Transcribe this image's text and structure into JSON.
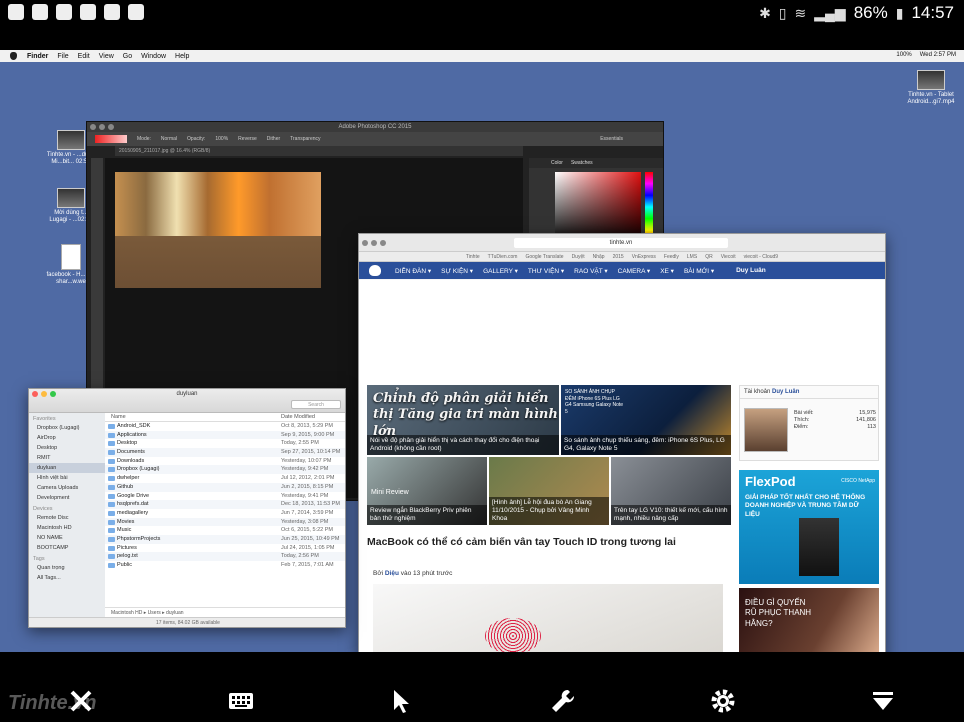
{
  "android": {
    "battery": "86%",
    "time": "14:57"
  },
  "mac_menubar": {
    "items": [
      "Finder",
      "File",
      "Edit",
      "View",
      "Go",
      "Window",
      "Help"
    ],
    "battery": "100%",
    "datetime": "Wed 2:57 PM"
  },
  "desktop_icons": [
    {
      "label": "Tinhte.vn - Tablet Android...gi7.mp4"
    },
    {
      "label": "Tinhte.vn - ...dụng Mi...bit... 02:50"
    },
    {
      "label": "Mời dùng t... Lugagi - ...02:50"
    },
    {
      "label": "facebook - H... get shar...w.we"
    }
  ],
  "photoshop": {
    "title": "Adobe Photoshop CC 2015",
    "doc_tab": "20150905_211017.jpg @ 16.4% (RGB/8)",
    "mode_label": "Mode:",
    "mode_value": "Normal",
    "opacity_label": "Opacity:",
    "opacity_value": "100%",
    "reverse": "Reverse",
    "dither": "Dither",
    "transparency": "Transparency",
    "workspace": "Essentials",
    "panel_tabs": [
      "Color",
      "Swatches"
    ]
  },
  "safari": {
    "url": "tinhte.vn",
    "bookmarks": [
      "Tinhte",
      "TTuDien.com",
      "Google Translate",
      "Duyệt",
      "Nhập",
      "2015",
      "VnExpress",
      "Feedly",
      "LMS",
      "QR",
      "Viecoit",
      "viecoit - Cloud9"
    ],
    "nav": [
      "DIỄN ĐÀN ▾",
      "SỰ KIỆN ▾",
      "GALLERY ▾",
      "THƯ VIỆN ▾",
      "RAO VẶT ▾",
      "CAMERA ▾",
      "XE ▾",
      "BÀI MỚI ▾"
    ],
    "user": "Duy Luân",
    "tiles": [
      {
        "overlay": "Chỉnh độ phân giải hiển thị Tăng gia tri màn hình lớn",
        "caption": "Nói về độ phân giải hiển thị và cách thay đổi cho điện thoại Android (không cần root)"
      },
      {
        "overlay": "SO SÁNH ẢNH CHỤP ĐÊM iPhone 6S Plus LG G4 Samsung Galaxy Note 5",
        "caption": "So sánh ảnh chụp thiếu sáng, đêm: iPhone 6S Plus, LG G4, Galaxy Note 5"
      },
      {
        "overlay": "Mini Review",
        "caption": "Review ngắn BlackBerry Priv phiên bản thử nghiệm"
      },
      {
        "overlay": "",
        "caption": "[Hình ảnh] Lễ hội đua bò An Giang 11/10/2015 - Chụp bởi Vâng Minh Khoa"
      },
      {
        "overlay": "",
        "caption": "Trên tay LG V10: thiết kế mới, cấu hình mạnh, nhiều nâng cấp"
      }
    ],
    "article_title": "MacBook có thể có cảm biến vân tay Touch ID trong tương lai",
    "article_by": "Bởi",
    "article_author": "Diệu",
    "article_time": "vào 13 phút trước",
    "account": {
      "title": "Tài khoản",
      "name": "Duy Luân",
      "stats": [
        {
          "label": "Bài viết:",
          "value": "15,975"
        },
        {
          "label": "Thích:",
          "value": "141,806"
        },
        {
          "label": "Điểm:",
          "value": "113"
        }
      ]
    },
    "ad_flexpod": {
      "brand": "FlexPod",
      "partners": "CISCO NetApp",
      "text": "GIẢI PHÁP TỐT NHẤT CHO HỆ THỐNG DOANH NGHIỆP VÀ TRUNG TÂM DỮ LIỆU"
    },
    "ad_2": {
      "text": "ĐIỀU GÌ QUYẾN RŨ PHỤC THANH HẰNG?"
    }
  },
  "finder": {
    "title": "duyluan",
    "search_placeholder": "Search",
    "col_name": "Name",
    "col_date": "Date Modified",
    "sidebar": {
      "favorites_label": "Favorites",
      "favorites": [
        "Dropbox (Lugagi)",
        "AirDrop",
        "Desktop",
        "RMIT",
        "duyluan",
        "Hình việt bài",
        "Camera Uploads",
        "Development"
      ],
      "devices_label": "Devices",
      "devices": [
        "Remote Disc",
        "Macintosh HD",
        "NO NAME",
        "BOOTCAMP"
      ],
      "tags_label": "Tags",
      "tags": [
        "Quan trọng",
        "All Tags..."
      ]
    },
    "rows": [
      {
        "name": "Android_SDK",
        "date": "Oct 8, 2013, 5:29 PM"
      },
      {
        "name": "Applications",
        "date": "Sep 9, 2015, 9:00 PM"
      },
      {
        "name": "Desktop",
        "date": "Today, 2:55 PM"
      },
      {
        "name": "Documents",
        "date": "Sep 27, 2015, 10:14 PM"
      },
      {
        "name": "Downloads",
        "date": "Yesterday, 10:07 PM"
      },
      {
        "name": "Dropbox (Lugagi)",
        "date": "Yesterday, 9:42 PM"
      },
      {
        "name": "dwhelper",
        "date": "Jul 12, 2012, 2:01 PM"
      },
      {
        "name": "Github",
        "date": "Jun 2, 2015, 8:15 PM"
      },
      {
        "name": "Google Drive",
        "date": "Yesterday, 9:41 PM"
      },
      {
        "name": "hsqlprefs.dat",
        "date": "Dec 18, 2013, 11:53 PM"
      },
      {
        "name": "mediagallery",
        "date": "Jun 7, 2014, 3:59 PM"
      },
      {
        "name": "Movies",
        "date": "Yesterday, 3:08 PM"
      },
      {
        "name": "Music",
        "date": "Oct 6, 2015, 5:22 PM"
      },
      {
        "name": "PhpstormProjects",
        "date": "Jun 25, 2015, 10:49 PM"
      },
      {
        "name": "Pictures",
        "date": "Jul 24, 2015, 1:05 PM"
      },
      {
        "name": "pelog.txt",
        "date": "Today, 2:56 PM"
      },
      {
        "name": "Public",
        "date": "Feb 7, 2015, 7:01 AM"
      }
    ],
    "path": "Macintosh HD ▸ Users ▸ duyluan",
    "status": "17 items, 84.02 GB available"
  },
  "bottom_bar": {
    "watermark": "Tinhte.vn",
    "buttons": [
      "close-icon",
      "keyboard-icon",
      "pointer-icon",
      "wrench-icon",
      "gear-icon",
      "menu-down-icon"
    ]
  }
}
